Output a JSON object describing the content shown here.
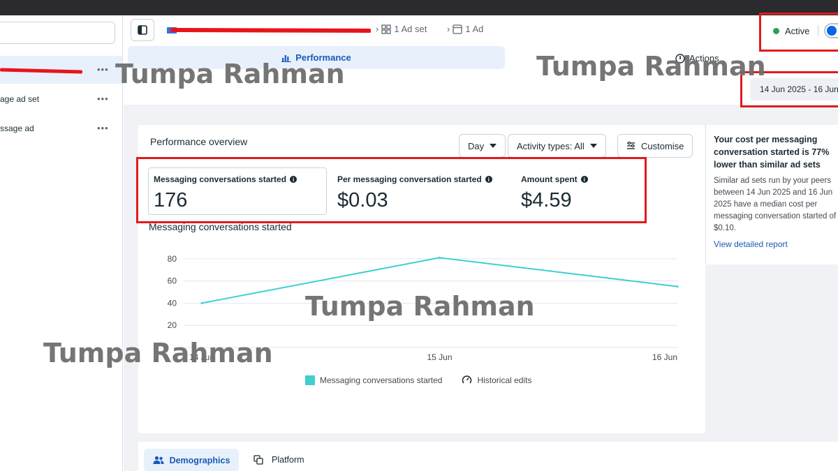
{
  "sidebar": {
    "items": [
      {
        "label": "",
        "more": "•••",
        "selected": true
      },
      {
        "label": "age ad set",
        "more": "•••"
      },
      {
        "label": "ssage ad",
        "more": "•••"
      }
    ]
  },
  "header": {
    "breadcrumb": {
      "adset": "1 Ad set",
      "ad": "1 Ad"
    },
    "status": "Active"
  },
  "tabs": {
    "performance": "Performance",
    "actions": "Actions"
  },
  "date_range": "14 Jun 2025 - 16 Jun",
  "overview": {
    "title": "Performance overview",
    "day_select": "Day",
    "activity_select": "Activity types: All",
    "customise": "Customise",
    "metrics": [
      {
        "label": "Messaging conversations started",
        "value": "176"
      },
      {
        "label": "Per messaging conversation started",
        "value": "$0.03"
      },
      {
        "label": "Amount spent",
        "value": "$4.59"
      }
    ],
    "chart_title": "Messaging conversations started",
    "legend": {
      "series": "Messaging conversations started",
      "edits": "Historical edits"
    }
  },
  "chart_data": {
    "type": "line",
    "x": [
      "14 Jun",
      "15 Jun",
      "16 Jun"
    ],
    "series": [
      {
        "name": "Messaging conversations started",
        "values": [
          40,
          81,
          55
        ]
      }
    ],
    "yticks": [
      20,
      40,
      60,
      80
    ],
    "ylim": [
      0,
      90
    ],
    "grid": true,
    "colors": {
      "line": "#3ecfce",
      "grid": "#e4e6eb"
    }
  },
  "insight": {
    "headline": "Your cost per messaging conversation started is 77% lower than similar ad sets",
    "body": "Similar ad sets run by your peers between 14 Jun 2025 and 16 Jun 2025 have a median cost per messaging conversation started of $0.10.",
    "link": "View detailed report"
  },
  "bottom_tabs": {
    "demographics": "Demographics",
    "platform": "Platform"
  },
  "watermark": "Tumpa Rahman",
  "colors": {
    "accent": "#1a5ab8",
    "highlight": "#e01b1b",
    "active_dot": "#2e9e4f"
  }
}
